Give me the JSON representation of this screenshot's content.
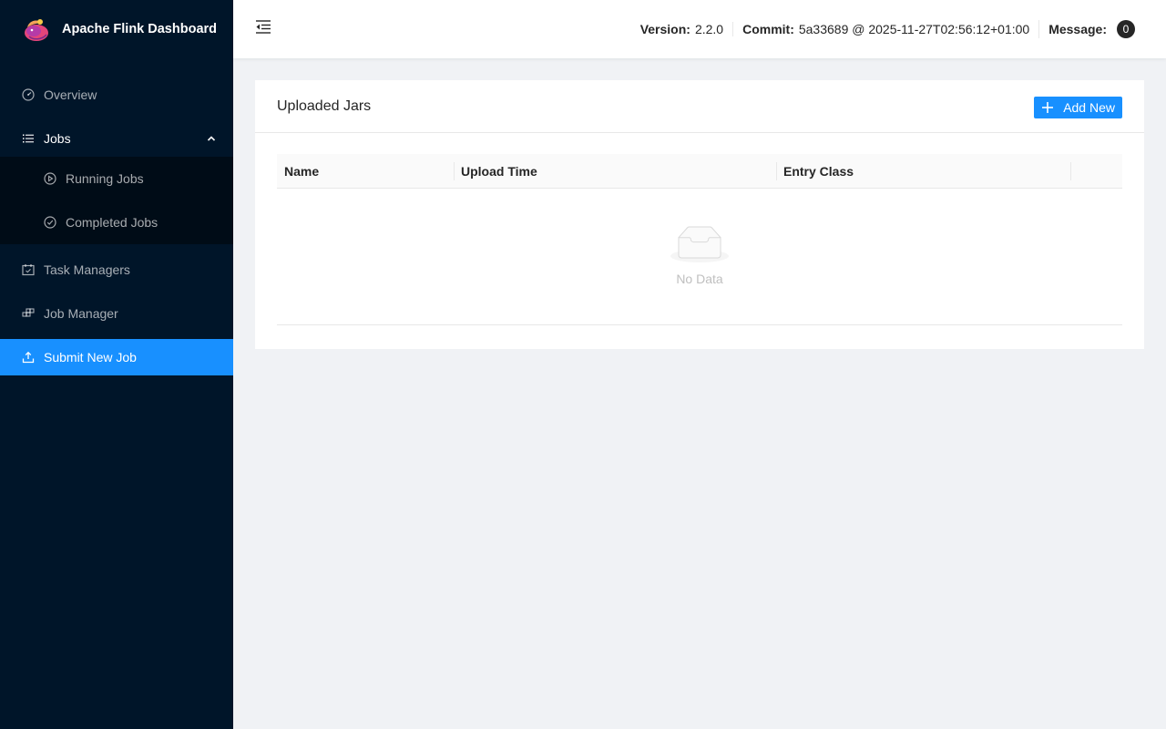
{
  "brand": {
    "title": "Apache Flink Dashboard"
  },
  "sidebar": {
    "items": [
      {
        "label": "Overview",
        "icon": "dashboard-icon"
      },
      {
        "label": "Jobs",
        "icon": "list-icon",
        "expanded": true,
        "children": [
          {
            "label": "Running Jobs",
            "icon": "play-circle-icon"
          },
          {
            "label": "Completed Jobs",
            "icon": "check-circle-icon"
          }
        ]
      },
      {
        "label": "Task Managers",
        "icon": "schedule-icon"
      },
      {
        "label": "Job Manager",
        "icon": "build-icon"
      },
      {
        "label": "Submit New Job",
        "icon": "upload-icon",
        "selected": true
      }
    ]
  },
  "header": {
    "version_label": "Version:",
    "version_value": "2.2.0",
    "commit_label": "Commit:",
    "commit_value": "5a33689 @ 2025-11-27T02:56:12+01:00",
    "message_label": "Message:",
    "message_count": "0"
  },
  "main": {
    "card_title": "Uploaded Jars",
    "add_button_label": "Add New",
    "table": {
      "columns": [
        "Name",
        "Upload Time",
        "Entry Class",
        ""
      ],
      "rows": [],
      "empty_text": "No Data"
    }
  },
  "colors": {
    "sidebar_bg": "#001529",
    "submenu_bg": "#000c17",
    "accent": "#1890ff"
  }
}
